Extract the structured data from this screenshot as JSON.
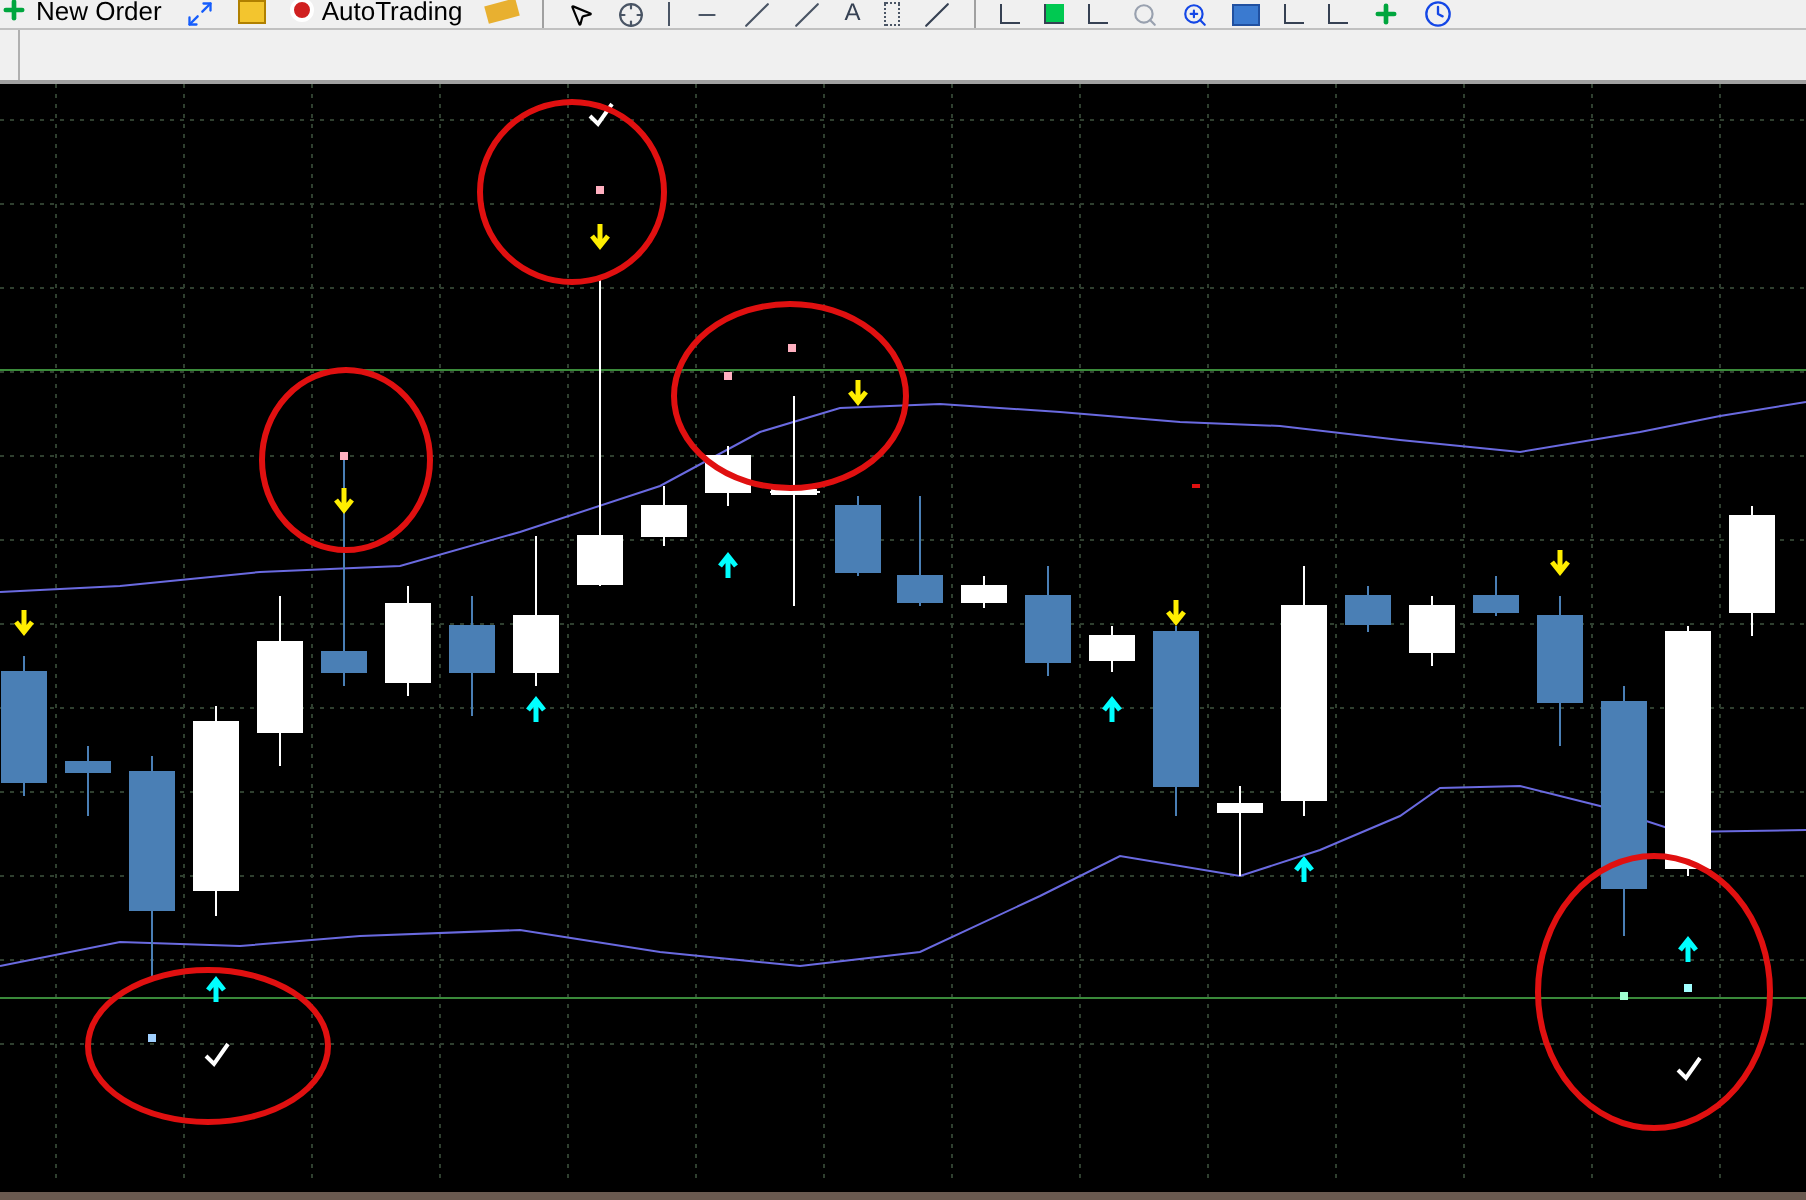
{
  "toolbar": {
    "new_order": "New Order",
    "auto_trading": "AutoTrading",
    "text_tool": "A"
  }
}
